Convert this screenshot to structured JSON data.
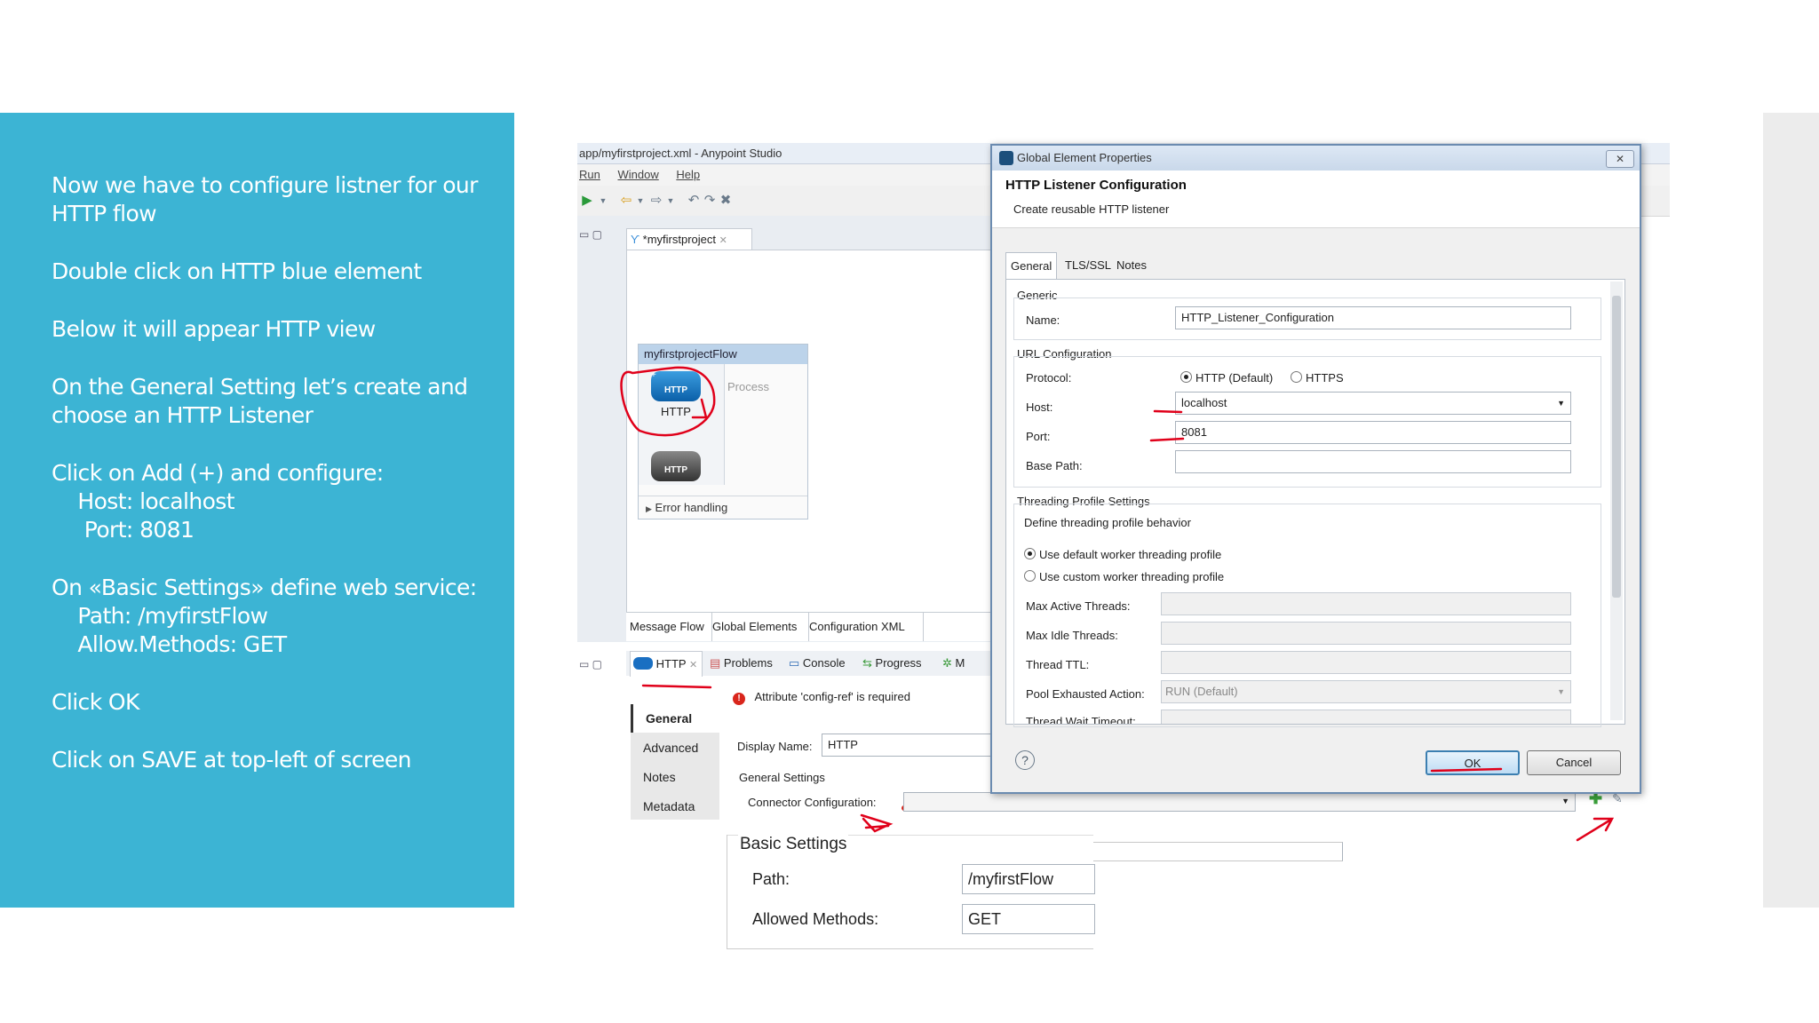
{
  "slide": {
    "instructions": [
      [
        "Now we have to configure listner for our",
        "HTTP flow"
      ],
      [
        "Double click on HTTP blue element"
      ],
      [
        "Below it will appear HTTP view"
      ],
      [
        "On the General Setting let’s create and",
        "choose an HTTP Listener"
      ],
      [
        "Click on Add (+) and configure:",
        "    Host: localhost",
        "     Port: 8081"
      ],
      [
        "On «Basic Settings» define web service:",
        "    Path: /myfirstFlow",
        "    Allow.Methods: GET"
      ],
      [
        "Click OK"
      ],
      [
        "Click on SAVE at top-left of screen"
      ]
    ]
  },
  "studio": {
    "window_title": "app/myfirstproject.xml - Anypoint Studio",
    "menu": [
      "Run",
      "Window",
      "Help"
    ],
    "editor_tab": "*myfirstproject",
    "flow": {
      "name": "myfirstprojectFlow",
      "source_label": "HTTP",
      "icon_text": "HTTP",
      "process_label": "Process",
      "error_handling": "Error handling"
    },
    "editor_bottom_tabs": [
      "Message Flow",
      "Global Elements",
      "Configuration XML"
    ],
    "props_tabs": [
      "HTTP",
      "Problems",
      "Console",
      "Progress",
      "M"
    ],
    "error_message": "Attribute 'config-ref' is required",
    "side_items": [
      "General",
      "Advanced",
      "Notes",
      "Metadata"
    ],
    "display_name_label": "Display Name:",
    "display_name_value": "HTTP",
    "general_settings_label": "General Settings",
    "connector_config_label": "Connector Configuration:",
    "basic_settings": {
      "title": "Basic Settings",
      "path_label": "Path:",
      "path_value": "/myfirstFlow",
      "methods_label": "Allowed Methods:",
      "methods_value": "GET"
    }
  },
  "dialog": {
    "window_title": "Global Element Properties",
    "close_label": "✕",
    "header_title": "HTTP Listener Configuration",
    "header_subtitle": "Create reusable HTTP listener",
    "tabs": [
      "General",
      "TLS/SSL",
      "Notes"
    ],
    "generic_title": "Generic",
    "name_label": "Name:",
    "name_value": "HTTP_Listener_Configuration",
    "url_title": "URL Configuration",
    "protocol_label": "Protocol:",
    "protocol_options": [
      "HTTP (Default)",
      "HTTPS"
    ],
    "host_label": "Host:",
    "host_value": "localhost",
    "port_label": "Port:",
    "port_value": "8081",
    "base_path_label": "Base Path:",
    "threading_title": "Threading Profile Settings",
    "threading_desc": "Define threading profile behavior",
    "threading_options": [
      "Use default worker threading profile",
      "Use custom worker threading profile"
    ],
    "max_active_label": "Max Active Threads:",
    "max_idle_label": "Max Idle Threads:",
    "thread_ttl_label": "Thread TTL:",
    "pool_exhausted_label": "Pool Exhausted Action:",
    "pool_exhausted_value": "RUN (Default)",
    "thread_wait_label": "Thread Wait Timeout:",
    "ok_label": "OK",
    "cancel_label": "Cancel"
  },
  "colors": {
    "panel_blue": "#3cb4d4",
    "annotation_red": "#e0001a"
  }
}
